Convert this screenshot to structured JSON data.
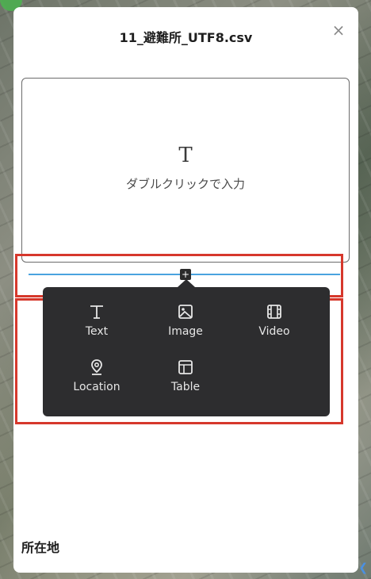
{
  "panel": {
    "title": "11_避難所_UTF8.csv",
    "close_symbol": "×"
  },
  "text_block": {
    "icon_glyph": "T",
    "placeholder": "ダブルクリックで入力"
  },
  "insert_button": {
    "symbol": "+"
  },
  "block_menu": {
    "items": [
      {
        "label": "Text",
        "icon": "text-icon"
      },
      {
        "label": "Image",
        "icon": "image-icon"
      },
      {
        "label": "Video",
        "icon": "video-icon"
      },
      {
        "label": "Location",
        "icon": "location-pin-icon"
      },
      {
        "label": "Table",
        "icon": "table-icon"
      }
    ]
  },
  "field": {
    "label": "所在地"
  },
  "colors": {
    "highlight": "#d6382c",
    "insert_line": "#4aa3df",
    "menu_bg": "#2d2d2f"
  }
}
